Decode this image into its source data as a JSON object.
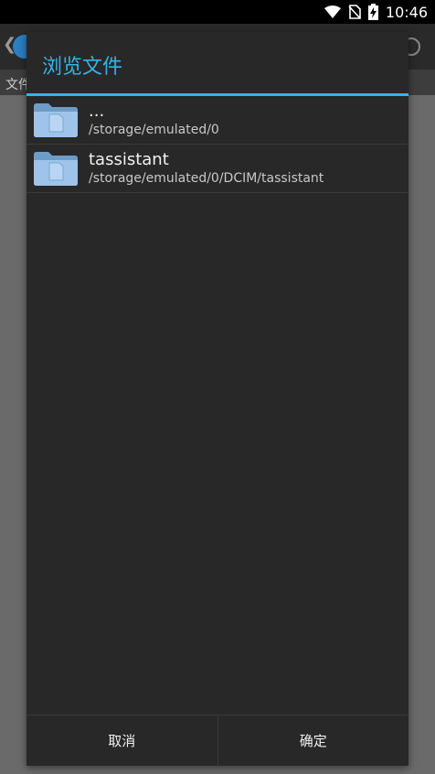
{
  "status_bar": {
    "time": "10:46",
    "icons": [
      "wifi-icon",
      "no-sim-icon",
      "battery-charging-icon"
    ]
  },
  "background": {
    "tab_label": "文件"
  },
  "dialog": {
    "title": "浏览文件",
    "accent_color": "#33b5e5",
    "items": [
      {
        "name": "...",
        "path": "/storage/emulated/0",
        "icon": "folder-icon"
      },
      {
        "name": "tassistant",
        "path": "/storage/emulated/0/DCIM/tassistant",
        "icon": "folder-icon"
      }
    ],
    "buttons": {
      "cancel": "取消",
      "confirm": "确定"
    }
  }
}
